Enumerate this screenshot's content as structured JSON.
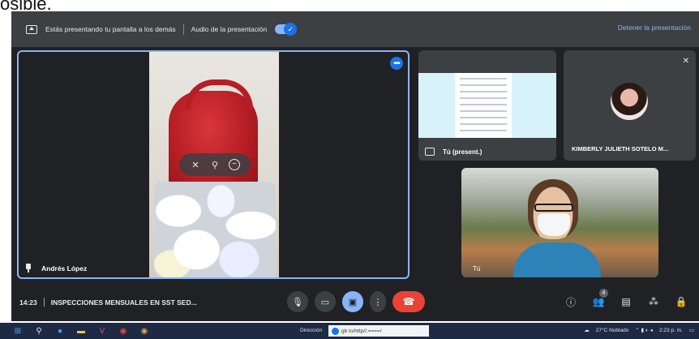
{
  "top_cut_text": "osible.",
  "banner": {
    "message": "Estás presentando tu pantalla a los demás",
    "audio_label": "Audio de la presentación",
    "toggle_state": "on",
    "stop_label": "Detener la presentación"
  },
  "main_tile": {
    "participant": "Andrés López",
    "hover_controls": [
      "mic-off-icon",
      "pin-icon",
      "remove-icon"
    ]
  },
  "present_tile": {
    "label": "Tú (present.)"
  },
  "kim_tile": {
    "label": "KIMBERLY JULIETH SOTELO M..."
  },
  "self_tile": {
    "label": "Tú"
  },
  "bottom_bar": {
    "time": "14:23",
    "meeting_title": "INSPECCIONES MENSUALES EN SST SED...",
    "people_count": "4"
  },
  "taskbar": {
    "address_label": "Dirección",
    "address_value": "gb to/http//:====/",
    "weather": "27°C Nublado",
    "clock": "2:23 p. m."
  },
  "colors": {
    "accent": "#8ab4f8",
    "meet_bg": "#202124",
    "end_call": "#ea4335"
  }
}
